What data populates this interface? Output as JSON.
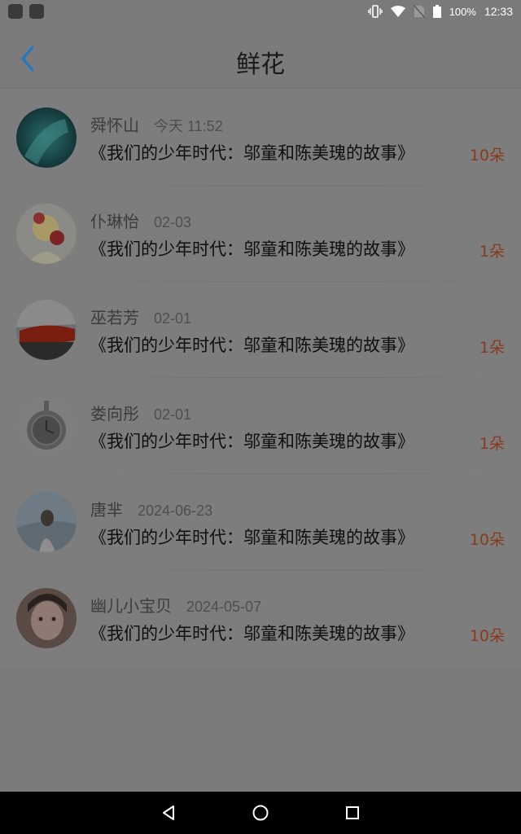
{
  "status_bar": {
    "battery": "100%",
    "time": "12:33"
  },
  "header": {
    "title": "鲜花"
  },
  "items": [
    {
      "name": "舜怀山",
      "time": "今天 11:52",
      "book": "《我们的少年时代：邬童和陈美瑰的故事》",
      "count": "10朵"
    },
    {
      "name": "仆琳怡",
      "time": "02-03",
      "book": "《我们的少年时代：邬童和陈美瑰的故事》",
      "count": "1朵"
    },
    {
      "name": "巫若芳",
      "time": "02-01",
      "book": "《我们的少年时代：邬童和陈美瑰的故事》",
      "count": "1朵"
    },
    {
      "name": "娄向彤",
      "time": "02-01",
      "book": "《我们的少年时代：邬童和陈美瑰的故事》",
      "count": "1朵"
    },
    {
      "name": "唐芈",
      "time": "2024-06-23",
      "book": "《我们的少年时代：邬童和陈美瑰的故事》",
      "count": "10朵"
    },
    {
      "name": "幽儿小宝贝",
      "time": "2024-05-07",
      "book": "《我们的少年时代：邬童和陈美瑰的故事》",
      "count": "10朵"
    }
  ],
  "colors": {
    "accent": "#1e78c8",
    "count": "#8a3a1c"
  }
}
